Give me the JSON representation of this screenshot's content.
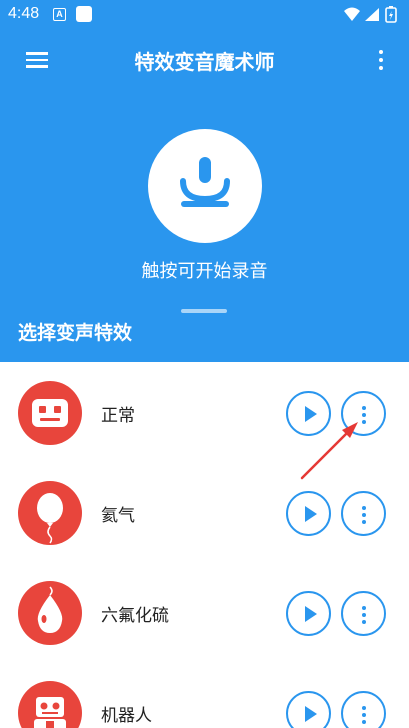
{
  "status_bar": {
    "time": "4:48",
    "notification_letter": "A",
    "icons": [
      "wifi-icon",
      "signal-icon",
      "battery-icon"
    ]
  },
  "app_bar": {
    "title": "特效变音魔术师",
    "menu_icon": "hamburger-menu-icon",
    "more_icon": "more-vert-icon"
  },
  "record": {
    "icon": "microphone-icon",
    "hint": "触按可开始录音"
  },
  "section": {
    "title": "选择变声特效"
  },
  "effects": [
    {
      "name": "正常",
      "icon": "robot-face-icon"
    },
    {
      "name": "氦气",
      "icon": "balloon-icon"
    },
    {
      "name": "六氟化硫",
      "icon": "gas-balloon-icon"
    },
    {
      "name": "机器人",
      "icon": "robot-icon"
    }
  ],
  "colors": {
    "primary": "#2a96ee",
    "avatar_bg": "#e8453c",
    "annotation_arrow": "#e53935"
  }
}
